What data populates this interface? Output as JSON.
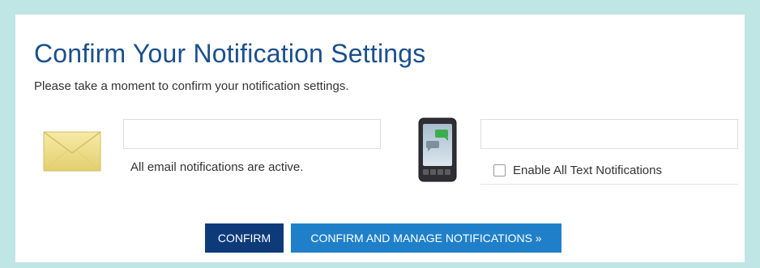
{
  "page": {
    "title": "Confirm Your Notification Settings",
    "subtitle": "Please take a moment to confirm your notification settings."
  },
  "email": {
    "icon": "envelope-icon",
    "field_value": "",
    "status": "All email notifications are active."
  },
  "text": {
    "icon": "mobile-phone-icon",
    "field_value": "",
    "checkbox_checked": false,
    "checkbox_label": "Enable All Text Notifications"
  },
  "buttons": {
    "confirm": "CONFIRM",
    "confirm_manage": "CONFIRM AND MANAGE NOTIFICATIONS »"
  },
  "colors": {
    "background": "#bfe5e5",
    "title": "#1a4f8c",
    "confirm_button": "#0d3b7a",
    "manage_button": "#1f80c9"
  }
}
